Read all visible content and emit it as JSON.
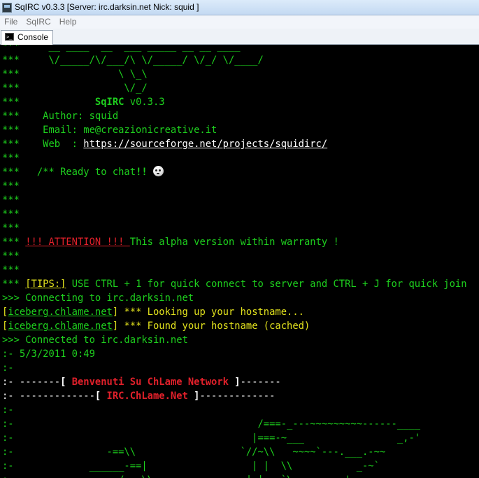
{
  "window": {
    "title": "SqIRC v0.3.3 [Server: irc.darksin.net Nick: squid ]"
  },
  "menu": [
    "File",
    "SqIRC",
    "Help"
  ],
  "tabs": [
    {
      "label": "Console",
      "icon": "console-icon"
    }
  ],
  "colors": {
    "console_bg": "#000000",
    "green": "#1ed01e",
    "yellow": "#e2e21d",
    "red": "#e0202a"
  },
  "console": {
    "lines": [
      [
        {
          "t": "***     __ ____ '__  ___ _____ __ __ ____  ",
          "c": "g"
        }
      ],
      [
        {
          "t": "***     \\/_____/\\/___/\\ \\/_____/ \\/_/ \\/____/",
          "c": "g"
        }
      ],
      [
        {
          "t": "***                 \\ \\_\\",
          "c": "g"
        }
      ],
      [
        {
          "t": "***                  \\/_/",
          "c": "g"
        }
      ],
      [
        {
          "t": "***             ",
          "c": "g"
        },
        {
          "t": "SqIRC",
          "c": "g b"
        },
        {
          "t": " v0.3.3",
          "c": "g"
        }
      ],
      [
        {
          "t": "***    Author: squid",
          "c": "g"
        }
      ],
      [
        {
          "t": "***    Email: me@creazionicreative.it",
          "c": "g"
        }
      ],
      [
        {
          "t": "***    Web  : ",
          "c": "g"
        },
        {
          "t": "https://sourceforge.net/projects/squidirc/",
          "c": "w u"
        }
      ],
      [
        {
          "t": "***",
          "c": "g"
        }
      ],
      [
        {
          "t": "***   /** Ready to chat",
          "c": "g"
        },
        {
          "t": "!!",
          "c": "g b"
        },
        {
          "t": " ",
          "c": "g"
        },
        {
          "smiley": true
        }
      ],
      [
        {
          "t": "***",
          "c": "g"
        }
      ],
      [
        {
          "t": "***",
          "c": "g"
        }
      ],
      [
        {
          "t": "***",
          "c": "g"
        }
      ],
      [
        {
          "t": "***",
          "c": "g"
        }
      ],
      [
        {
          "t": "*** ",
          "c": "g"
        },
        {
          "t": "!!! ATTENTION !!! ",
          "c": "r u"
        },
        {
          "t": "This alpha version within warranty !",
          "c": "g"
        }
      ],
      [
        {
          "t": "***",
          "c": "g"
        }
      ],
      [
        {
          "t": "***",
          "c": "g"
        }
      ],
      [
        {
          "t": "*** ",
          "c": "g"
        },
        {
          "t": "[TIPS:]",
          "c": "y u"
        },
        {
          "t": " USE CTRL + 1 for quick connect to server and CTRL + J for quick join",
          "c": "g"
        }
      ],
      [
        {
          "t": ">>> Connecting to irc.darksin.net",
          "c": "g"
        }
      ],
      [
        {
          "t": "[",
          "c": "y"
        },
        {
          "t": "iceberg.chlame.net",
          "c": "g u"
        },
        {
          "t": "] *** Looking up your hostname...",
          "c": "y"
        }
      ],
      [
        {
          "t": "[",
          "c": "y"
        },
        {
          "t": "iceberg.chlame.net",
          "c": "g u"
        },
        {
          "t": "] *** Found your hostname (cached)",
          "c": "y"
        }
      ],
      [
        {
          "t": ">>> Connected to irc.darksin.net",
          "c": "g"
        }
      ],
      [
        {
          "t": ":- 5/3/2011 0:49",
          "c": "g"
        }
      ],
      [
        {
          "t": ":-",
          "c": "g"
        }
      ],
      [
        {
          "t": ":- -------",
          "c": "w"
        },
        {
          "t": "[",
          "c": "w b"
        },
        {
          "t": " Benvenuti Su ChLame Network ",
          "c": "r b"
        },
        {
          "t": "]",
          "c": "w b"
        },
        {
          "t": "-------",
          "c": "w"
        }
      ],
      [
        {
          "t": ":- -------------",
          "c": "w"
        },
        {
          "t": "[",
          "c": "w b"
        },
        {
          "t": " IRC.ChLame.Net ",
          "c": "r b"
        },
        {
          "t": "]",
          "c": "w b"
        },
        {
          "t": "-------------",
          "c": "w"
        }
      ],
      [
        {
          "t": ":-",
          "c": "g"
        }
      ],
      [
        {
          "t": ":-                                          /===-_---~~~~~~~~~------____",
          "c": "g"
        }
      ],
      [
        {
          "t": ":-                                         |===-~___                _,-'",
          "c": "g"
        }
      ],
      [
        {
          "t": ":-                -==\\\\                  `//~\\\\   ~~~~`---.___.-~~",
          "c": "g"
        }
      ],
      [
        {
          "t": ":-             ______-==|                  | |  \\\\           _-~`",
          "c": "g"
        }
      ],
      [
        {
          "t": ":-       __--~~~  ,-/-==\\\\                | |   `\\        ,'",
          "c": "g"
        }
      ]
    ]
  }
}
